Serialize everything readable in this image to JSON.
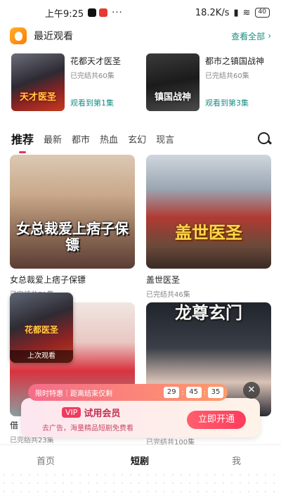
{
  "status": {
    "time": "上午9:25",
    "dots": "···",
    "speed": "18.2K/s",
    "battery": "40"
  },
  "recent": {
    "title": "最近观看",
    "view_all": "查看全部",
    "items": [
      {
        "title": "花都天才医圣",
        "status": "已完结共60集",
        "progress": "观看到第1集",
        "poster_text": "天才医圣"
      },
      {
        "title": "都市之镇国战神",
        "status": "已完结共60集",
        "progress": "观看到第3集",
        "poster_text": "镇国战神"
      }
    ]
  },
  "tabs": [
    "推荐",
    "最新",
    "都市",
    "热血",
    "玄幻",
    "现言"
  ],
  "cards": [
    {
      "title": "女总裁爱上痞子保镖",
      "status": "已完结共71集",
      "poster_text": "女总裁爱上痞子保镖"
    },
    {
      "title": "盖世医圣",
      "status": "已完结共46集",
      "poster_text": "盖世医圣"
    },
    {
      "title": "借",
      "status": "已完结共23集"
    },
    {
      "status": "已完结共100集",
      "poster_text": "龙尊玄门"
    }
  ],
  "last_watched": {
    "label": "上次观看",
    "poster_text": "花都医圣"
  },
  "vip": {
    "deal_text": "限时特惠｜距离结束仅剩",
    "countdown": [
      "29",
      "45",
      "35"
    ],
    "badge": "VIP",
    "title": "试用会员",
    "subtitle": "去广告，海量精品短剧免费看",
    "cta": "立即开通"
  },
  "nav": {
    "home": "首页",
    "drama": "短剧",
    "mine": "我"
  }
}
